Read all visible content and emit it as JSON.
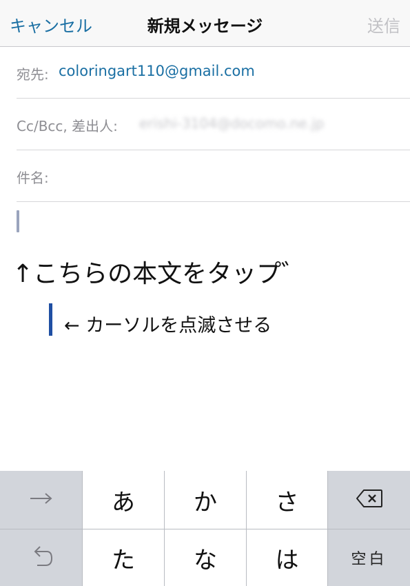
{
  "nav": {
    "cancel": "キャンセル",
    "title": "新規メッセージ",
    "send": "送信"
  },
  "fields": {
    "to_label": "宛先:",
    "to_value": "coloringart110@gmail.com",
    "ccbcc_label": "Cc/Bcc, 差出人:",
    "ccbcc_value": "erishi-3104@docomo.ne.jp",
    "subject_label": "件名:"
  },
  "annotations": {
    "tap_body": "↑こちらの本文をタップ゛",
    "blink_cursor": "← カーソルを点滅させる"
  },
  "keyboard": {
    "row1": [
      "あ",
      "か",
      "さ"
    ],
    "row2": [
      "た",
      "な",
      "は"
    ],
    "space_label": "空白",
    "icons": {
      "next": "arrow-right-icon",
      "delete": "delete-backspace-icon",
      "undo": "undo-icon"
    }
  },
  "colors": {
    "accent": "#1a6fa3",
    "send_disabled": "#c1c1c5",
    "cursor": "#9aa4bd",
    "annotation_bar": "#1f4fa3",
    "keyboard_bg": "#d2d5db"
  }
}
